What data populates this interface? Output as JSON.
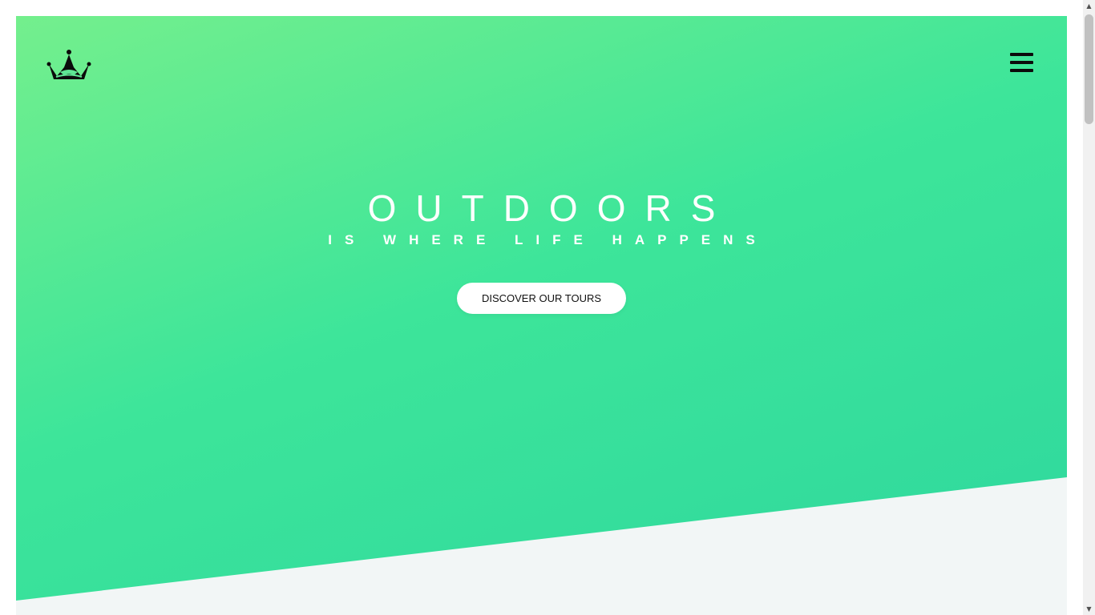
{
  "header": {
    "logo_icon": "crown-icon",
    "menu_icon": "hamburger-menu-icon"
  },
  "hero": {
    "title": "OUTDOORS",
    "subtitle": "IS WHERE LIFE HAPPENS",
    "cta_label": "DISCOVER OUR TOURS"
  },
  "scrollbar": {
    "up_arrow": "▲",
    "down_arrow": "▼"
  },
  "colors": {
    "gradient_start": "#74ef8d",
    "gradient_end": "#2ed79e",
    "section_background": "#f2f6f6",
    "text_light": "#ffffff",
    "button_text": "#111111"
  }
}
